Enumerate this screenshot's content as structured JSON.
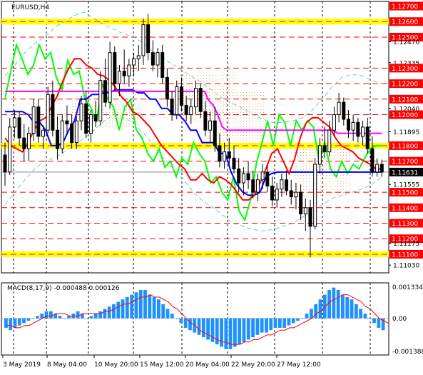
{
  "header": {
    "symbol": "EURUSD,H4"
  },
  "macd_panel": {
    "label": "MACD(8,17,9) -0.000488 0.000126"
  },
  "colors": {
    "background": "#ffffff",
    "candle": "#000000",
    "red_level": "#ff0000",
    "yellow_level": "#ffff00",
    "price_tag": "#ff0000",
    "current_tag": "#000000",
    "lime_line": "#00ff00",
    "blue_line": "#0000ff",
    "red_line": "#ff0000",
    "magenta_line": "#ff00ff",
    "envelope": "#5fd3b3",
    "cloud_dots": "#f4a460",
    "macd_hist": "#1e90ff",
    "macd_signal": "#ff0000"
  },
  "chart_data": {
    "type": "candlestick",
    "symbol": "EURUSD",
    "timeframe": "H4",
    "price_axis": {
      "range": [
        1.1098,
        1.1273
      ],
      "tick_labels": [
        {
          "value": 1.127,
          "label": "1.12700",
          "tag": true
        },
        {
          "value": 1.126,
          "label": "1.12600",
          "tag": true
        },
        {
          "value": 1.125,
          "label": "1.12500",
          "tag": true
        },
        {
          "value": 1.1247,
          "label": "1.12470",
          "tag": false
        },
        {
          "value": 1.12335,
          "label": "1.12335",
          "tag": false
        },
        {
          "value": 1.123,
          "label": "1.12300",
          "tag": true
        },
        {
          "value": 1.122,
          "label": "1.12200",
          "tag": true
        },
        {
          "value": 1.121,
          "label": "1.12100",
          "tag": true
        },
        {
          "value": 1.1204,
          "label": "1.12040",
          "tag": false
        },
        {
          "value": 1.12,
          "label": "1.12000",
          "tag": true
        },
        {
          "value": 1.1189,
          "label": "1.11895",
          "tag": false
        },
        {
          "value": 1.118,
          "label": "1.11800",
          "tag": true
        },
        {
          "value": 1.117,
          "label": "1.11700",
          "tag": true
        },
        {
          "value": 1.1163,
          "label": "1.11631",
          "tag": true,
          "current": true
        },
        {
          "value": 1.1155,
          "label": "1.11555",
          "tag": false
        },
        {
          "value": 1.115,
          "label": "1.11500",
          "tag": true
        },
        {
          "value": 1.114,
          "label": "1.11400",
          "tag": true
        },
        {
          "value": 1.113,
          "label": "1.11300",
          "tag": true
        },
        {
          "value": 1.112,
          "label": "1.11200",
          "tag": true
        },
        {
          "value": 1.1117,
          "label": "1.11175",
          "tag": false
        },
        {
          "value": 1.111,
          "label": "1.11100",
          "tag": true
        },
        {
          "value": 1.1103,
          "label": "1.11030",
          "tag": false
        }
      ]
    },
    "red_levels": [
      1.125,
      1.123,
      1.122,
      1.121,
      1.12,
      1.117,
      1.115,
      1.114,
      1.113,
      1.112
    ],
    "yellow_levels": [
      1.126,
      1.118,
      1.111
    ],
    "current_price": 1.1163,
    "date_labels": [
      "3 May 2019",
      "8 May 04:00",
      "10 May 20:00",
      "15 May 12:00",
      "20 May 04:00",
      "22 May 20:00",
      "27 May 12:00"
    ],
    "candles": [
      [
        1.1174,
        1.1182,
        1.1154,
        1.1163
      ],
      [
        1.1163,
        1.1198,
        1.1161,
        1.1192
      ],
      [
        1.1192,
        1.1203,
        1.1185,
        1.1198
      ],
      [
        1.1198,
        1.1202,
        1.118,
        1.1185
      ],
      [
        1.1185,
        1.1194,
        1.117,
        1.1178
      ],
      [
        1.1178,
        1.1192,
        1.117,
        1.1188
      ],
      [
        1.1188,
        1.121,
        1.1183,
        1.1205
      ],
      [
        1.1205,
        1.121,
        1.1182,
        1.1186
      ],
      [
        1.1186,
        1.1193,
        1.1178,
        1.119
      ],
      [
        1.119,
        1.1218,
        1.1188,
        1.1213
      ],
      [
        1.1213,
        1.1222,
        1.1186,
        1.119
      ],
      [
        1.119,
        1.1199,
        1.1171,
        1.1178
      ],
      [
        1.1178,
        1.12,
        1.1175,
        1.1196
      ],
      [
        1.1196,
        1.1206,
        1.1187,
        1.1194
      ],
      [
        1.1194,
        1.12,
        1.1178,
        1.1182
      ],
      [
        1.1182,
        1.1199,
        1.1178,
        1.1196
      ],
      [
        1.1196,
        1.1212,
        1.119,
        1.1207
      ],
      [
        1.1207,
        1.1215,
        1.1185,
        1.1188
      ],
      [
        1.1188,
        1.1203,
        1.1182,
        1.12
      ],
      [
        1.12,
        1.1209,
        1.1192,
        1.1196
      ],
      [
        1.1196,
        1.1228,
        1.1193,
        1.1222
      ],
      [
        1.1222,
        1.1236,
        1.1205,
        1.1208
      ],
      [
        1.1208,
        1.1247,
        1.1204,
        1.124
      ],
      [
        1.124,
        1.1244,
        1.1216,
        1.122
      ],
      [
        1.122,
        1.1232,
        1.1212,
        1.1228
      ],
      [
        1.1228,
        1.1242,
        1.122,
        1.1225
      ],
      [
        1.1225,
        1.1236,
        1.1218,
        1.1232
      ],
      [
        1.1232,
        1.124,
        1.1225,
        1.1236
      ],
      [
        1.1236,
        1.1245,
        1.1228,
        1.1238
      ],
      [
        1.1238,
        1.1262,
        1.1232,
        1.1258
      ],
      [
        1.1258,
        1.1265,
        1.1235,
        1.124
      ],
      [
        1.124,
        1.1248,
        1.1228,
        1.1232
      ],
      [
        1.1232,
        1.1243,
        1.1224,
        1.124
      ],
      [
        1.124,
        1.1245,
        1.122,
        1.1224
      ],
      [
        1.1224,
        1.123,
        1.1205,
        1.121
      ],
      [
        1.121,
        1.1215,
        1.1196,
        1.12
      ],
      [
        1.12,
        1.1222,
        1.1197,
        1.1218
      ],
      [
        1.1218,
        1.1224,
        1.1202,
        1.1206
      ],
      [
        1.1206,
        1.1212,
        1.1196,
        1.12
      ],
      [
        1.12,
        1.121,
        1.1194,
        1.1205
      ],
      [
        1.1205,
        1.1222,
        1.12,
        1.1217
      ],
      [
        1.1217,
        1.122,
        1.1198,
        1.1202
      ],
      [
        1.1202,
        1.1209,
        1.1186,
        1.119
      ],
      [
        1.119,
        1.1202,
        1.1182,
        1.1196
      ],
      [
        1.1196,
        1.1205,
        1.1176,
        1.118
      ],
      [
        1.118,
        1.1188,
        1.1166,
        1.117
      ],
      [
        1.117,
        1.1182,
        1.1165,
        1.1176
      ],
      [
        1.1176,
        1.1185,
        1.1168,
        1.1172
      ],
      [
        1.1172,
        1.118,
        1.1162,
        1.1165
      ],
      [
        1.1165,
        1.1172,
        1.115,
        1.1156
      ],
      [
        1.1156,
        1.1166,
        1.1148,
        1.1162
      ],
      [
        1.1162,
        1.117,
        1.1152,
        1.1158
      ],
      [
        1.1158,
        1.1164,
        1.1146,
        1.115
      ],
      [
        1.115,
        1.1162,
        1.1144,
        1.1158
      ],
      [
        1.1158,
        1.1168,
        1.1152,
        1.1163
      ],
      [
        1.1163,
        1.1168,
        1.115,
        1.1154
      ],
      [
        1.1154,
        1.116,
        1.1141,
        1.1145
      ],
      [
        1.1145,
        1.1156,
        1.114,
        1.1152
      ],
      [
        1.1152,
        1.1162,
        1.1147,
        1.1158
      ],
      [
        1.1158,
        1.1164,
        1.1148,
        1.1151
      ],
      [
        1.1151,
        1.1158,
        1.1142,
        1.1147
      ],
      [
        1.1147,
        1.1156,
        1.1139,
        1.115
      ],
      [
        1.115,
        1.1155,
        1.1132,
        1.1136
      ],
      [
        1.1136,
        1.1146,
        1.1125,
        1.114
      ],
      [
        1.114,
        1.1145,
        1.1108,
        1.1128
      ],
      [
        1.1128,
        1.1172,
        1.1126,
        1.1168
      ],
      [
        1.1168,
        1.1185,
        1.1162,
        1.118
      ],
      [
        1.118,
        1.1192,
        1.1172,
        1.1176
      ],
      [
        1.1176,
        1.1196,
        1.1173,
        1.119
      ],
      [
        1.119,
        1.1205,
        1.1186,
        1.12
      ],
      [
        1.12,
        1.1214,
        1.1195,
        1.1208
      ],
      [
        1.1208,
        1.1211,
        1.1193,
        1.1197
      ],
      [
        1.1197,
        1.1203,
        1.1185,
        1.119
      ],
      [
        1.119,
        1.12,
        1.1183,
        1.1195
      ],
      [
        1.1195,
        1.1198,
        1.1182,
        1.1186
      ],
      [
        1.1186,
        1.1196,
        1.118,
        1.1192
      ],
      [
        1.1192,
        1.1198,
        1.1175,
        1.1178
      ],
      [
        1.1178,
        1.1186,
        1.116,
        1.1163
      ],
      [
        1.1163,
        1.1172,
        1.116,
        1.1168
      ],
      [
        1.1168,
        1.1171,
        1.116,
        1.1163
      ]
    ],
    "overlay_lines": [
      {
        "color": "#00ff00",
        "values": [
          1.121,
          1.1228,
          1.1245,
          1.1236,
          1.1226,
          1.1232,
          1.1245,
          1.1236,
          1.124,
          1.1224,
          1.1216,
          1.1235,
          1.1226,
          1.1228,
          1.121,
          1.1205,
          1.1195,
          1.122,
          1.121,
          1.1205,
          1.119,
          1.1205,
          1.121,
          1.119,
          1.1185,
          1.1175,
          1.117,
          1.1178,
          1.1166,
          1.117,
          1.116,
          1.1172,
          1.1168,
          1.1182,
          1.1175,
          1.117,
          1.1156,
          1.116,
          1.115,
          1.1145,
          1.116,
          1.1138,
          1.1132,
          1.1145,
          1.1168,
          1.1182,
          1.1196,
          1.118,
          1.12,
          1.1195,
          1.118,
          1.1196,
          1.119,
          1.1196,
          1.1192,
          1.117,
          1.1182,
          1.1165,
          1.116,
          1.117,
          1.1162,
          1.1168,
          1.1165,
          1.1172,
          1.1178,
          1.118,
          1.118
        ]
      },
      {
        "color": "#0000ff",
        "values": [
          1.1202,
          1.1202,
          1.1202,
          1.1202,
          1.12,
          1.1195,
          1.1195,
          1.119,
          1.118,
          1.118,
          1.1182,
          1.119,
          1.1196,
          1.121,
          1.121,
          1.1213,
          1.1213,
          1.1214,
          1.1214,
          1.1216,
          1.1216,
          1.1216,
          1.1216,
          1.1214,
          1.1214,
          1.121,
          1.121,
          1.1204,
          1.1204,
          1.12,
          1.12,
          1.1196,
          1.119,
          1.119,
          1.1182,
          1.1182,
          1.1182,
          1.1175,
          1.1175,
          1.1163,
          1.1155,
          1.115,
          1.1148,
          1.1148,
          1.115,
          1.116,
          1.1162,
          1.1163,
          1.1163,
          1.1163,
          1.1163,
          1.1163,
          1.1163,
          1.1163,
          1.1163,
          1.1163,
          1.1163,
          1.1163,
          1.1163,
          1.1163,
          1.1163,
          1.1163,
          1.1163,
          1.1163,
          1.1163,
          1.1163
        ]
      },
      {
        "color": "#ff0000",
        "values": [
          1.1185,
          1.118,
          1.1178,
          1.1176,
          1.1182,
          1.119,
          1.1196,
          1.1198,
          1.1205,
          1.1212,
          1.1222,
          1.123,
          1.1236,
          1.1236,
          1.1232,
          1.123,
          1.1226,
          1.1225,
          1.1222,
          1.1218,
          1.1212,
          1.1208,
          1.1202,
          1.12,
          1.1196,
          1.1192,
          1.1186,
          1.118,
          1.1176,
          1.1172,
          1.1168,
          1.1165,
          1.1158,
          1.1158,
          1.1162,
          1.1158,
          1.1156,
          1.116,
          1.1158,
          1.1155,
          1.115,
          1.1145,
          1.1145,
          1.1148,
          1.1156,
          1.1165,
          1.1175,
          1.1178,
          1.117,
          1.1162,
          1.1172,
          1.1186,
          1.1195,
          1.1198,
          1.1198,
          1.1195,
          1.1192,
          1.1185,
          1.118,
          1.1178,
          1.1176,
          1.1172,
          1.117,
          1.1168,
          1.1165,
          1.1165
        ]
      },
      {
        "color": "#ff00ff",
        "values": [
          1.1215,
          1.1215,
          1.1215,
          1.1215,
          1.1215,
          1.1215,
          1.1215,
          1.1215,
          1.1215,
          1.1215,
          1.1215,
          1.1215,
          1.1215,
          1.1215,
          1.1215,
          1.1215,
          1.1215,
          1.1215,
          1.1215,
          1.1215,
          1.1215,
          1.1215,
          1.1215,
          1.1215,
          1.1215,
          1.1215,
          1.1215,
          1.1215,
          1.1215,
          1.1215,
          1.1215,
          1.1215,
          1.1215,
          1.1215,
          1.1215,
          1.1215,
          1.1215,
          1.1215,
          1.1215,
          1.1215,
          1.1215,
          1.1215,
          1.1215,
          1.1215,
          1.1215,
          1.1215,
          1.1209,
          1.1206,
          1.12,
          1.1192,
          1.119,
          1.119,
          1.119,
          1.119,
          1.119,
          1.119,
          1.119,
          1.119,
          1.119,
          1.119,
          1.119,
          1.119,
          1.119,
          1.119,
          1.119,
          1.119,
          1.119,
          1.119,
          1.119,
          1.119,
          1.119,
          1.119,
          1.119,
          1.119,
          1.119,
          1.1188,
          1.1188,
          1.1188,
          1.1188,
          1.1188,
          1.1188,
          1.1188,
          1.1188,
          1.1188,
          1.1188,
          1.1188
        ]
      },
      {
        "color": "#5fd3b3",
        "values": [
          1.1225,
          1.1232,
          1.124,
          1.1246,
          1.125,
          1.1256,
          1.126,
          1.1264,
          1.1266,
          1.1262,
          1.1258,
          1.1255,
          1.1252,
          1.125,
          1.1246,
          1.124,
          1.1236,
          1.1232,
          1.1228,
          1.1224,
          1.122,
          1.1215,
          1.121,
          1.1207,
          1.1204,
          1.12,
          1.1197,
          1.1195,
          1.1195,
          1.1196,
          1.1198,
          1.1203,
          1.121,
          1.1218,
          1.1224,
          1.1226,
          1.1225,
          1.1222,
          1.122
        ]
      },
      {
        "color": "#5fd3b3",
        "values": [
          1.1142,
          1.115,
          1.1158,
          1.1165,
          1.117,
          1.1172,
          1.1176,
          1.118,
          1.1185,
          1.119,
          1.1196,
          1.12,
          1.1198,
          1.1194,
          1.1188,
          1.118,
          1.1172,
          1.1165,
          1.1158,
          1.115,
          1.1144,
          1.114,
          1.1135,
          1.113,
          1.1128,
          1.1126,
          1.1125,
          1.1126,
          1.1128,
          1.113,
          1.1134,
          1.1138,
          1.1142,
          1.1146,
          1.1148,
          1.115,
          1.1152,
          1.1155,
          1.116
        ]
      }
    ],
    "macd": {
      "label": "MACD(8,17,9)",
      "main": -0.000488,
      "signal": 0.000126,
      "axis_labels": [
        {
          "value": 0.001334,
          "label": "0.001334"
        },
        {
          "value": 0.0,
          "label": "0.00"
        },
        {
          "value": -0.001388,
          "label": "-0.001388"
        }
      ],
      "histogram": [
        -0.0004,
        -0.0005,
        -0.0004,
        -0.0003,
        -0.0002,
        -0.0001,
        0.0,
        0.0001,
        0.0002,
        0.0003,
        0.0003,
        0.0002,
        0.0001,
        0.0,
        0.0001,
        0.0002,
        0.0003,
        0.0002,
        0.0,
        0.0001,
        0.0002,
        0.0003,
        0.0004,
        0.0005,
        0.0006,
        0.0007,
        0.0008,
        0.0009,
        0.001,
        0.0011,
        0.0012,
        0.0012,
        0.001,
        0.0009,
        0.0008,
        0.0006,
        0.0004,
        0.0002,
        0.0,
        -0.0002,
        -0.0004,
        -0.0005,
        -0.0006,
        -0.0007,
        -0.0008,
        -0.0009,
        -0.001,
        -0.0011,
        -0.0012,
        -0.0013,
        -0.0013,
        -0.0012,
        -0.0011,
        -0.001,
        -0.0009,
        -0.0008,
        -0.0007,
        -0.0006,
        -0.0006,
        -0.0005,
        -0.0004,
        -0.0004,
        -0.0004,
        -0.0003,
        -0.0002,
        -0.0001,
        0.0,
        0.0002,
        0.0004,
        0.0006,
        0.0008,
        0.001,
        0.0012,
        0.0013,
        0.0012,
        0.001,
        0.0009,
        0.0008,
        0.0006,
        0.0004,
        0.0002,
        0.0,
        -0.0002,
        -0.0004,
        -0.0005
      ],
      "signal_line": [
        -0.0003,
        -0.0003,
        -0.0004,
        -0.0004,
        -0.0003,
        -0.0003,
        -0.0002,
        -0.0001,
        0.0,
        0.0001,
        0.0001,
        0.0002,
        0.0002,
        0.0002,
        0.0001,
        0.0001,
        0.0001,
        0.0002,
        0.0002,
        0.0002,
        0.0002,
        0.0002,
        0.0003,
        0.0003,
        0.0004,
        0.0005,
        0.0006,
        0.0006,
        0.0007,
        0.0008,
        0.0009,
        0.0009,
        0.001,
        0.0009,
        0.0009,
        0.0008,
        0.0007,
        0.0005,
        0.0004,
        0.0002,
        0.0,
        -0.0002,
        -0.0003,
        -0.0005,
        -0.0006,
        -0.0007,
        -0.0008,
        -0.0009,
        -0.001,
        -0.001,
        -0.0011,
        -0.0011,
        -0.0011,
        -0.001,
        -0.001,
        -0.0009,
        -0.0009,
        -0.0008,
        -0.0007,
        -0.0007,
        -0.0006,
        -0.0005,
        -0.0005,
        -0.0004,
        -0.0004,
        -0.0003,
        -0.0002,
        -0.0001,
        0.0,
        0.0002,
        0.0003,
        0.0005,
        0.0007,
        0.0008,
        0.0009,
        0.001,
        0.001,
        0.0009,
        0.0008,
        0.0007,
        0.0005,
        0.0004,
        0.0002,
        0.0,
        -0.0001,
        -0.0002
      ]
    }
  }
}
